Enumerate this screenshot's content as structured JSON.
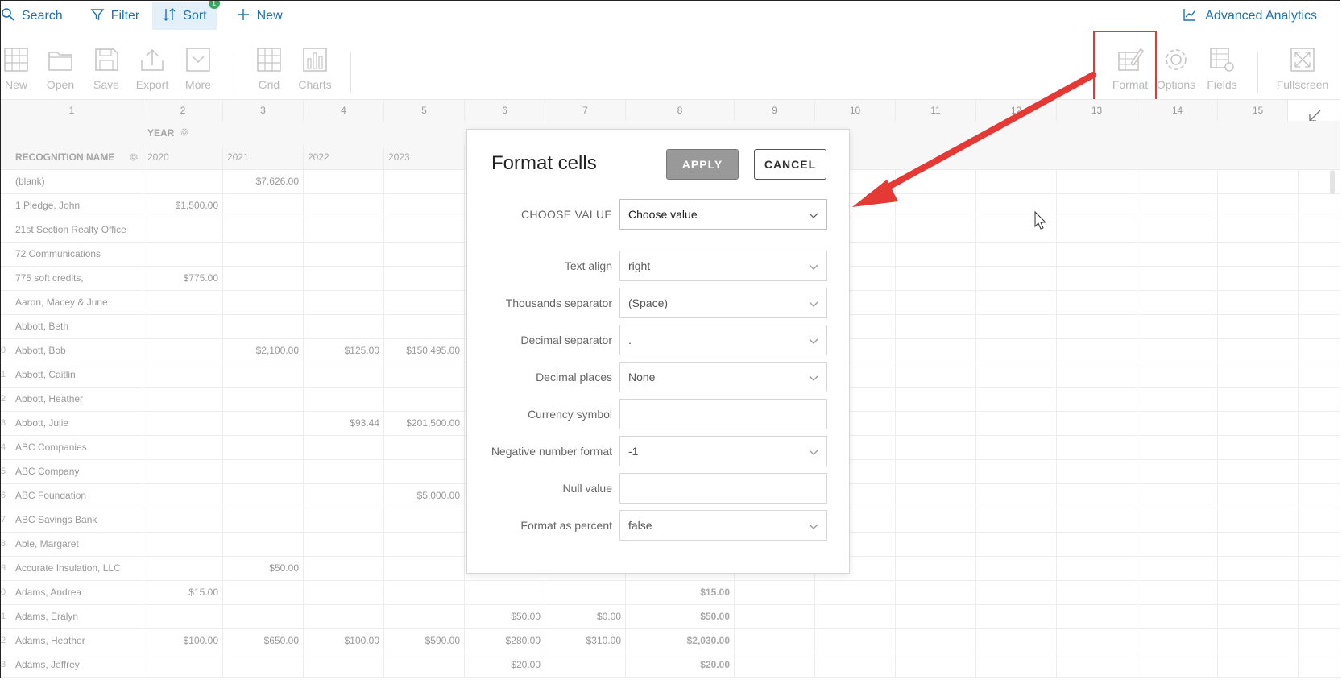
{
  "topbar": {
    "search": "Search",
    "filter": "Filter",
    "sort": "Sort",
    "sort_badge": "1",
    "new": "New",
    "advanced": "Advanced Analytics"
  },
  "toolbar": {
    "new": "New",
    "open": "Open",
    "save": "Save",
    "export": "Export",
    "more": "More",
    "grid": "Grid",
    "charts": "Charts",
    "format": "Format",
    "options": "Options",
    "fields": "Fields",
    "fullscreen": "Fullscreen"
  },
  "grid": {
    "col_numbers": [
      "1",
      "2",
      "3",
      "4",
      "5",
      "6",
      "7",
      "8",
      "9",
      "10",
      "11",
      "12",
      "13",
      "14",
      "15"
    ],
    "year_header": "YEAR",
    "name_header": "RECOGNITION NAME",
    "years": [
      "2020",
      "2021",
      "2022",
      "2023"
    ],
    "rows": [
      {
        "n": "",
        "name": "(blank)",
        "c": [
          "",
          "$7,626.00",
          "",
          "",
          "",
          "",
          ""
        ]
      },
      {
        "n": "",
        "name": "1 Pledge, John",
        "c": [
          "$1,500.00",
          "",
          "",
          "",
          "",
          "",
          ""
        ]
      },
      {
        "n": "",
        "name": "21st Section Realty Office",
        "c": [
          "",
          "",
          "",
          "",
          "",
          "",
          ""
        ]
      },
      {
        "n": "",
        "name": "72 Communications",
        "c": [
          "",
          "",
          "",
          "",
          "",
          "",
          ""
        ]
      },
      {
        "n": "",
        "name": "775 soft credits,",
        "c": [
          "$775.00",
          "",
          "",
          "",
          "",
          "",
          ""
        ]
      },
      {
        "n": "",
        "name": "Aaron, Macey & June",
        "c": [
          "",
          "",
          "",
          "",
          "",
          "",
          ""
        ]
      },
      {
        "n": "",
        "name": "Abbott, Beth",
        "c": [
          "",
          "",
          "",
          "",
          "",
          "",
          ""
        ]
      },
      {
        "n": "0",
        "name": "Abbott, Bob",
        "c": [
          "",
          "$2,100.00",
          "$125.00",
          "$150,495.00",
          "",
          "",
          ""
        ]
      },
      {
        "n": "1",
        "name": "Abbott, Caitlin",
        "c": [
          "",
          "",
          "",
          "",
          "",
          "",
          ""
        ]
      },
      {
        "n": "2",
        "name": "Abbott, Heather",
        "c": [
          "",
          "",
          "",
          "",
          "",
          "",
          ""
        ]
      },
      {
        "n": "3",
        "name": "Abbott, Julie",
        "c": [
          "",
          "",
          "$93.44",
          "$201,500.00",
          "",
          "",
          ""
        ]
      },
      {
        "n": "4",
        "name": "ABC Companies",
        "c": [
          "",
          "",
          "",
          "",
          "",
          "",
          ""
        ]
      },
      {
        "n": "5",
        "name": "ABC Company",
        "c": [
          "",
          "",
          "",
          "",
          "",
          "",
          ""
        ]
      },
      {
        "n": "6",
        "name": "ABC Foundation",
        "c": [
          "",
          "",
          "",
          "$5,000.00",
          "",
          "",
          ""
        ]
      },
      {
        "n": "7",
        "name": "ABC Savings Bank",
        "c": [
          "",
          "",
          "",
          "",
          "",
          "",
          ""
        ]
      },
      {
        "n": "8",
        "name": "Able, Margaret",
        "c": [
          "",
          "",
          "",
          "",
          "",
          "",
          ""
        ]
      },
      {
        "n": "9",
        "name": "Accurate Insulation, LLC",
        "c": [
          "",
          "$50.00",
          "",
          "",
          "",
          "",
          ""
        ]
      },
      {
        "n": "0",
        "name": "Adams, Andrea",
        "c": [
          "$15.00",
          "",
          "",
          "",
          "",
          "",
          "$15.00"
        ]
      },
      {
        "n": "1",
        "name": "Adams, Eralyn",
        "c": [
          "",
          "",
          "",
          "",
          "$50.00",
          "$0.00",
          "$50.00"
        ]
      },
      {
        "n": "2",
        "name": "Adams, Heather",
        "c": [
          "$100.00",
          "$650.00",
          "$100.00",
          "$590.00",
          "$280.00",
          "$310.00",
          "$2,030.00"
        ]
      },
      {
        "n": "3",
        "name": "Adams, Jeffrey",
        "c": [
          "",
          "",
          "",
          "",
          "$20.00",
          "",
          "$20.00"
        ]
      }
    ]
  },
  "dialog": {
    "title": "Format cells",
    "apply": "APPLY",
    "cancel": "CANCEL",
    "choose_label": "CHOOSE VALUE",
    "choose_value": "Choose value",
    "fields": [
      {
        "label": "Text align",
        "value": "right"
      },
      {
        "label": "Thousands separator",
        "value": "(Space)"
      },
      {
        "label": "Decimal separator",
        "value": "."
      },
      {
        "label": "Decimal places",
        "value": "None"
      },
      {
        "label": "Currency symbol",
        "value": ""
      },
      {
        "label": "Negative number format",
        "value": "-1"
      },
      {
        "label": "Null value",
        "value": ""
      },
      {
        "label": "Format as percent",
        "value": "false"
      }
    ]
  },
  "colors": {
    "accent": "#1a73b8",
    "highlight": "#e53935",
    "apply_bg": "#999999"
  }
}
